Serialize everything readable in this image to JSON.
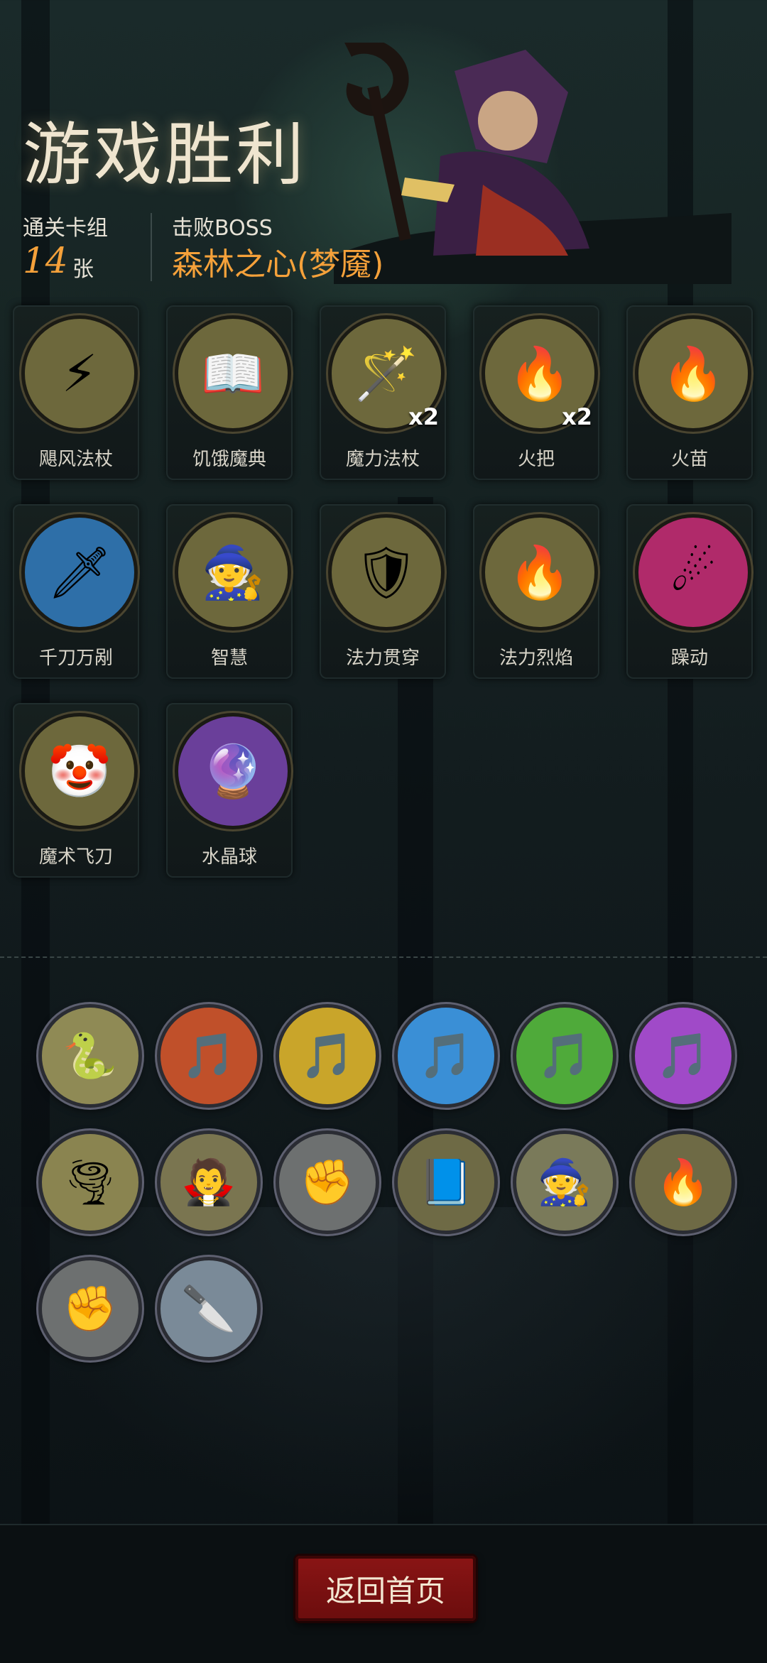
{
  "header": {
    "title": "游戏胜利",
    "deck_label": "通关卡组",
    "deck_count": "14",
    "deck_unit": "张",
    "boss_label": "击败BOSS",
    "boss_name": "森林之心(梦魇)"
  },
  "cards": [
    {
      "name": "飓风法杖",
      "icon": "staff-lightning-icon",
      "glyph": "⚡",
      "badge": ""
    },
    {
      "name": "饥饿魔典",
      "icon": "hungry-tome-icon",
      "glyph": "📖",
      "badge": ""
    },
    {
      "name": "魔力法杖",
      "icon": "magic-staff-icon",
      "glyph": "🪄",
      "badge": "x2"
    },
    {
      "name": "火把",
      "icon": "torch-icon",
      "glyph": "🔥",
      "badge": "x2"
    },
    {
      "name": "火苗",
      "icon": "flame-hand-icon",
      "glyph": "🔥",
      "badge": ""
    },
    {
      "name": "千刀万剐",
      "icon": "blades-storm-icon",
      "glyph": "🗡",
      "badge": ""
    },
    {
      "name": "智慧",
      "icon": "wise-sage-icon",
      "glyph": "🧙",
      "badge": ""
    },
    {
      "name": "法力贯穿",
      "icon": "mana-pierce-icon",
      "glyph": "🛡",
      "badge": ""
    },
    {
      "name": "法力烈焰",
      "icon": "mana-blaze-icon",
      "glyph": "🔥",
      "badge": ""
    },
    {
      "name": "躁动",
      "icon": "frenzy-icon",
      "glyph": "☄",
      "badge": ""
    },
    {
      "name": "魔术飞刀",
      "icon": "juggler-knives-icon",
      "glyph": "🤡",
      "badge": ""
    },
    {
      "name": "水晶球",
      "icon": "crystal-ball-icon",
      "glyph": "🔮",
      "badge": ""
    }
  ],
  "relics": [
    {
      "icon": "serpent-tentacle-icon",
      "glyph": "🐍",
      "bg": "#8f8a55"
    },
    {
      "icon": "singing-skull-red-icon",
      "glyph": "🎵",
      "bg": "#c0502a"
    },
    {
      "icon": "singing-skull-yellow-icon",
      "glyph": "🎵",
      "bg": "#c9a52a"
    },
    {
      "icon": "singing-skull-blue-icon",
      "glyph": "🎵",
      "bg": "#3a8fd6"
    },
    {
      "icon": "singing-skull-green-icon",
      "glyph": "🎵",
      "bg": "#4faa3a"
    },
    {
      "icon": "singing-skull-purple-icon",
      "glyph": "🎵",
      "bg": "#a04ac8"
    },
    {
      "icon": "whirlwind-icon",
      "glyph": "🌪",
      "bg": "#8a8450"
    },
    {
      "icon": "vampire-icon",
      "glyph": "🧛",
      "bg": "#7a7550"
    },
    {
      "icon": "bleeding-fist-icon",
      "glyph": "✊",
      "bg": "#6d7070"
    },
    {
      "icon": "sealed-book-icon",
      "glyph": "📘",
      "bg": "#6e6a45"
    },
    {
      "icon": "wizard-icon",
      "glyph": "🧙",
      "bg": "#7a7a5a"
    },
    {
      "icon": "blue-campfire-icon",
      "glyph": "🔥",
      "bg": "#6e6a45"
    },
    {
      "icon": "bleeding-fist-icon",
      "glyph": "✊",
      "bg": "#6d7070"
    },
    {
      "icon": "dagger-icon",
      "glyph": "🔪",
      "bg": "#7a8a98"
    }
  ],
  "footer": {
    "back_label": "返回首页"
  },
  "colors": {
    "accent": "#f5a13a",
    "button": "#8a1515"
  }
}
